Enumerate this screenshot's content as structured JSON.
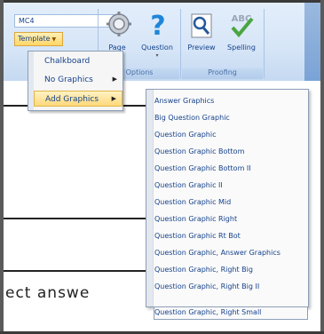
{
  "ribbon": {
    "combo_value": "MC4",
    "template_label": "Template",
    "groups": [
      {
        "label": "Options",
        "buttons": [
          {
            "label": "Page"
          },
          {
            "label": "Question"
          }
        ]
      },
      {
        "label": "Proofing",
        "buttons": [
          {
            "label": "Preview"
          },
          {
            "label": "Spelling"
          }
        ]
      }
    ]
  },
  "template_menu": {
    "items": [
      {
        "label": "Chalkboard",
        "has_submenu": false
      },
      {
        "label": "No Graphics",
        "has_submenu": true
      },
      {
        "label": "Add Graphics",
        "has_submenu": true,
        "selected": true
      }
    ]
  },
  "add_graphics_submenu": {
    "items": [
      "Answer Graphics",
      "Big Question Graphic",
      "Question Graphic",
      "Question Graphic Bottom",
      "Question Graphic Bottom II",
      "Question Graphic II",
      "Question Graphic Mid",
      "Question Graphic Right",
      "Question Graphic Rt Bot",
      "Question Graphic, Answer Graphics",
      "Question Graphic, Right Big",
      "Question Graphic, Right Big II",
      "Question Graphic, Right Small"
    ]
  },
  "document": {
    "visible_text": "ect answe"
  },
  "colors": {
    "ribbon_bg": "#d6e5f7",
    "menu_highlight": "#ffd97a",
    "text": "#15428b"
  }
}
